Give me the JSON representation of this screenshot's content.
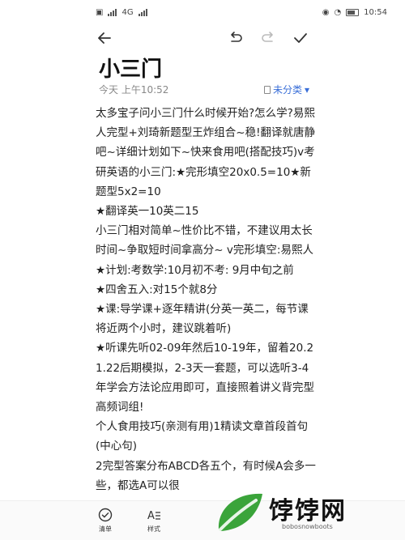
{
  "status_bar": {
    "time": "10:54",
    "network": "4G"
  },
  "note": {
    "title": "小三门",
    "timestamp": "今天 上午10:52",
    "category_label": "未分类",
    "paragraphs": [
      "太多宝子问小三门什么时候开始?怎么学?易熙人完型+刘琦新题型王炸组合~稳!翻译就唐静吧~详细计划如下~快来食用吧(搭配技巧)v考研英语的小三门:★完形填空20x0.5=10★新题型5x2=10",
      "★翻译英一10英二15",
      "小三门相对简单~性价比不错，不建议用太长时间~争取短时间拿高分~ v完形填空:易熙人★计划:考数学:10月初不考: 9月中旬之前",
      "★四舍五入:对15个就8分",
      "★课:导学课+逐年精讲(分英一英二，每节课将近两个小时，建议跳着听)",
      "★听课先听02-09年然后10-19年，留着20.21.22后期模拟，2-3天一套题，可以选听3-4年学会方法论应用即可，直接照着讲义背完型高频词组!",
      "个人食用技巧(亲测有用)1精读文章首段首句(中心句)",
      "2完型答案分布ABCD各五个，有时候A会多一些，都选A可以很"
    ]
  },
  "bottom_bar": {
    "items": [
      {
        "label": "清单",
        "icon": "check-circle-icon"
      },
      {
        "label": "样式",
        "icon": "text-style-icon"
      }
    ]
  },
  "watermark": {
    "text": "饽饽网",
    "sub": "bobosnowboots"
  }
}
